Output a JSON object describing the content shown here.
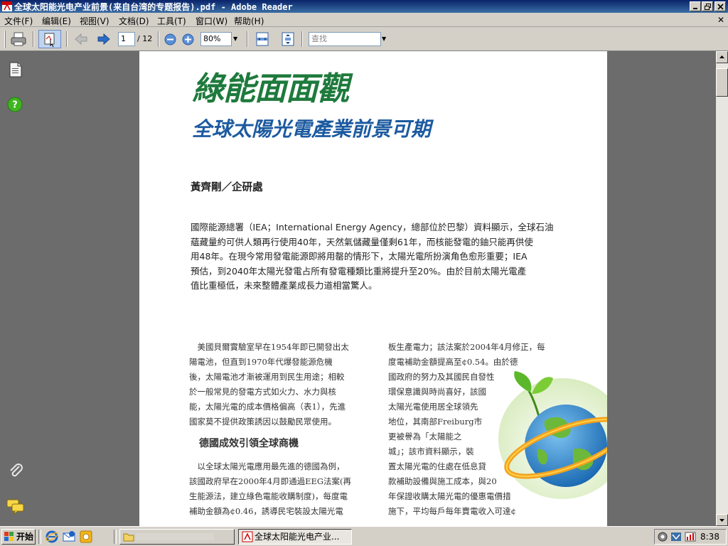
{
  "window": {
    "title": "全球太阳能光电产业前景(来自台湾的专题报告).pdf - Adobe Reader"
  },
  "menu": [
    "文件(F)",
    "编辑(E)",
    "视图(V)",
    "文档(D)",
    "工具(T)",
    "窗口(W)",
    "帮助(H)"
  ],
  "toolbar": {
    "page_value": "1",
    "page_total": "/ 12",
    "zoom_value": "80%",
    "search_placeholder": "查找"
  },
  "document": {
    "title_main": "綠能面面觀",
    "title_sub": "全球太陽光電產業前景可期",
    "author": "黃齊剛／企研處",
    "abstract": "國際能源總署（IEA；International Energy Agency，總部位於巴黎）資料顯示，全球石油\n蘊藏量約可供人類再行使用40年，天然氣儲藏量僅剩61年，而核能發電的鈾只能再供使\n用48年。在現今常用發電能源即將用罄的情形下，太陽光電所扮演角色愈形重要；IEA\n預估，到2040年太陽光發電占所有發電種類比重將提升至20%。由於目前太陽光電產\n值比重極低，未來整體產業成長力道相當驚人。",
    "col1_para1": "　美國貝爾實驗室早在1954年即已開發出太\n陽電池，但直到1970年代爆發能源危機\n後，太陽電池才漸被運用到民生用途；相較\n於一般常見的發電方式如火力、水力與核\n能，太陽光電的成本價格偏高（表1），先進\n國家莫不提供政策誘因以鼓勵民眾使用。",
    "col1_heading": "德國成效引領全球商機",
    "col1_para2": "　以全球太陽光電應用最先進的德國為例，\n該國政府早在2000年4月即通過EEG法案(再\n生能源法，建立綠色電能收購制度)，每度電\n補助金額為¢0.46，誘導民宅裝設太陽光電",
    "col2_text": "板生產電力；該法案於2004年4月修正，每\n度電補助金額提高至¢0.54。由於德\n國政府的努力及其國民自發性\n環保意識與時尚喜好，該國\n太陽光電使用居全球領先\n地位，其南部Freiburg市\n更被譽為「太陽能之\n城」；該市資料顯示，裝\n置太陽光電的住處在低息貸\n款補助設備與施工成本，與20\n年保證收購太陽光電的優惠電價措\n施下，平均每戶每年賣電收入可達¢"
  },
  "taskbar": {
    "start_label": "开始",
    "task1_label": "",
    "task2_label": "全球太阳能光电产业...",
    "clock": "8:38"
  }
}
